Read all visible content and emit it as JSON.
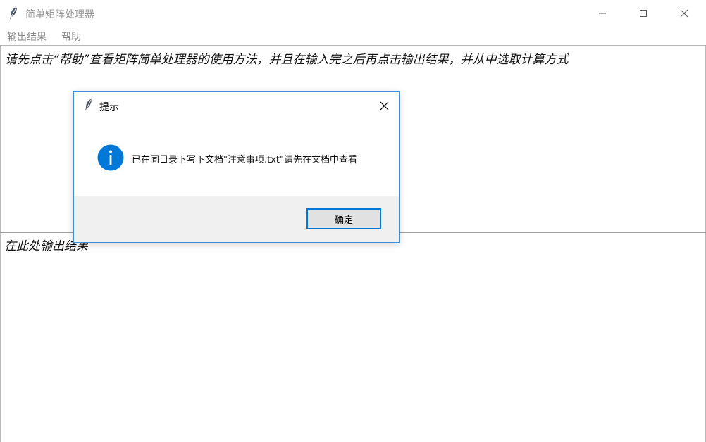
{
  "window": {
    "title": "简单矩阵处理器",
    "controls": {
      "minimize_icon": "minimize-icon",
      "maximize_icon": "maximize-icon",
      "close_icon": "close-icon"
    }
  },
  "menubar": {
    "items": [
      {
        "label": "输出结果"
      },
      {
        "label": "帮助"
      }
    ]
  },
  "input_area": {
    "text": "请先点击“帮助”查看矩阵简单处理器的使用方法，并且在输入完之后再点击输出结果，并从中选取计算方式"
  },
  "output_area": {
    "text": "在此处输出结果"
  },
  "dialog": {
    "title": "提示",
    "message": "已在同目录下写下文档\"注意事项.txt\"请先在文档中查看",
    "ok_label": "确定",
    "icon": "info-icon",
    "accent_color": "#0078d7"
  }
}
